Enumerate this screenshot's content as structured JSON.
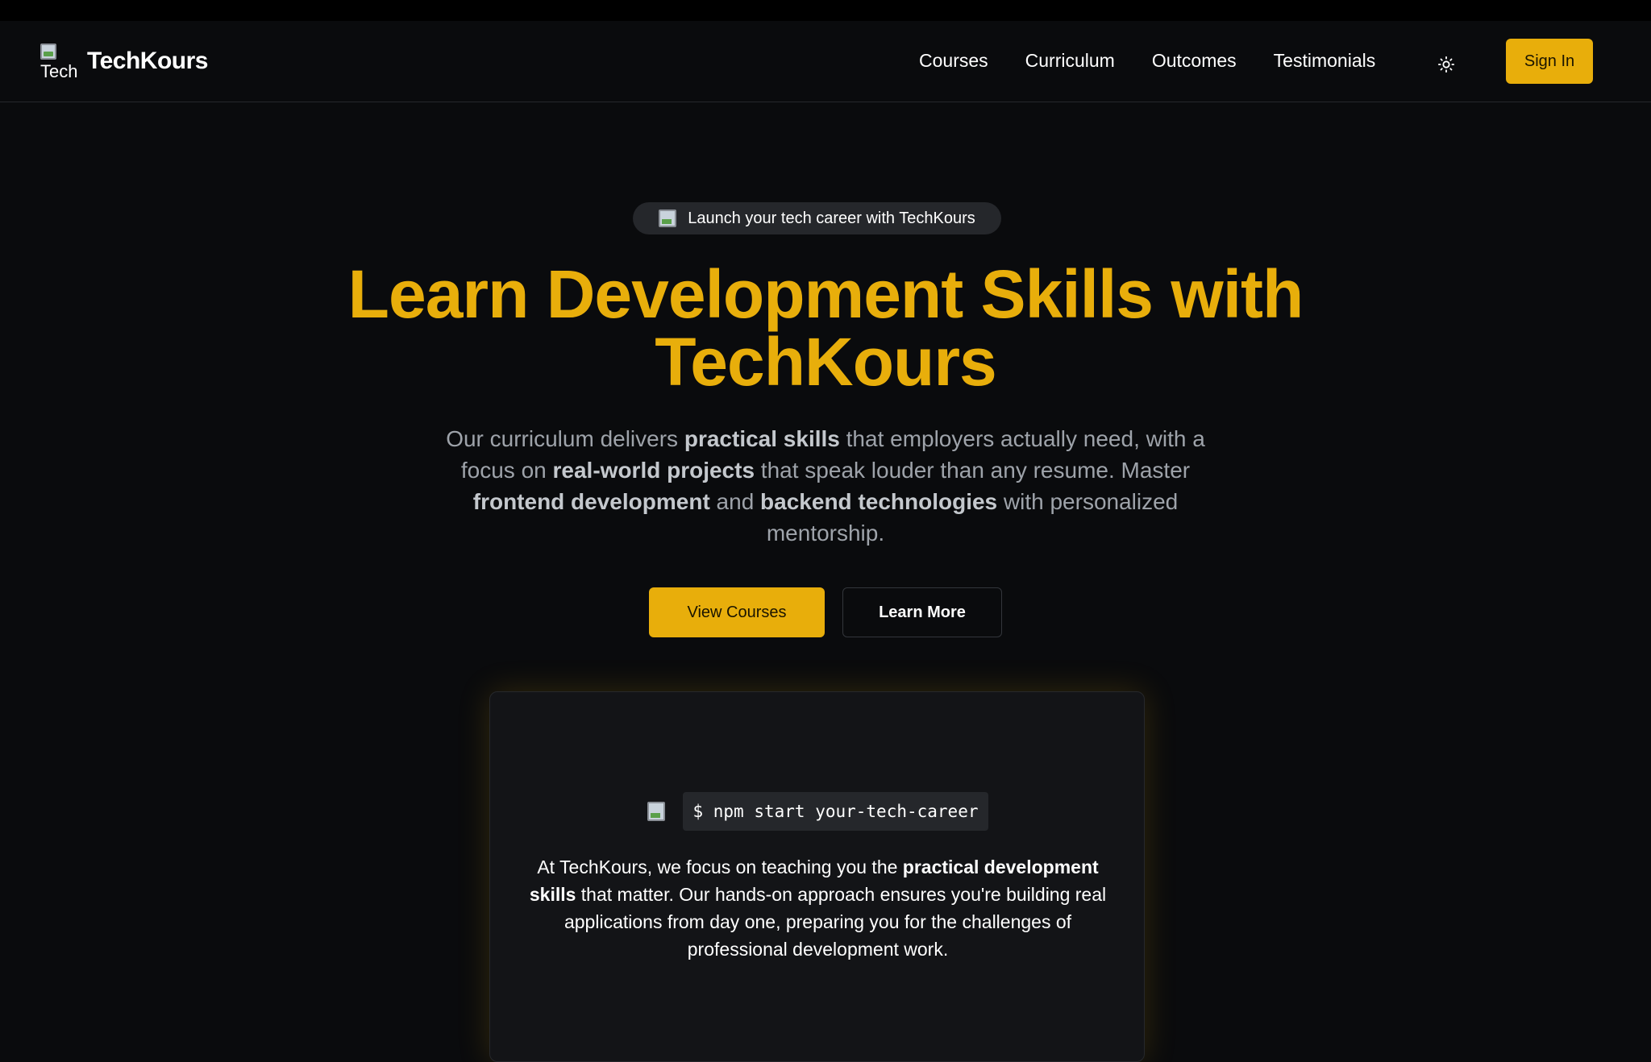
{
  "brand": {
    "logo_alt": "Tech",
    "name": "TechKours"
  },
  "nav": {
    "links": [
      "Courses",
      "Curriculum",
      "Outcomes",
      "Testimonials"
    ],
    "theme_icon": "sun-icon",
    "signin_label": "Sign In"
  },
  "hero": {
    "pill_text": "Launch your tech career with TechKours",
    "title_line1": "Learn Development Skills with",
    "title_line2": "TechKours",
    "subtitle_parts": [
      "Our curriculum delivers ",
      "practical skills",
      " that employers actually need, with a focus on ",
      "real-world projects",
      " that speak louder than any resume. Master ",
      "frontend development",
      " and ",
      "backend technologies",
      " with personalized mentorship."
    ],
    "primary_cta": "View Courses",
    "secondary_cta": "Learn More"
  },
  "card": {
    "command": "$ npm start your-tech-career",
    "text_parts": [
      "At TechKours, we focus on teaching you the ",
      "practical development skills",
      " that matter. Our hands-on approach ensures you're building real applications from day one, preparing you for the challenges of professional development work."
    ]
  },
  "colors": {
    "accent": "#e8ae0b",
    "background": "#0a0b0d",
    "card": "#131417"
  }
}
